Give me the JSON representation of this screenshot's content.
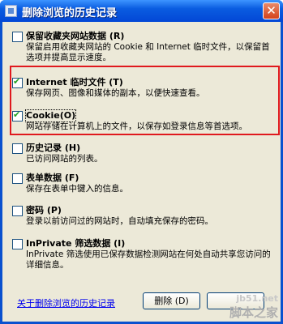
{
  "window": {
    "title": "删除浏览的历史记录",
    "close_glyph": "✕"
  },
  "options": [
    {
      "label": "保留收藏夹网站数据 (R)",
      "checked": false,
      "desc": "保留启用收藏夹网站的 Cookie 和 Internet 临时文件，以保留首选项并提高显示速度。"
    },
    {
      "label": "Internet 临时文件 (T)",
      "checked": true,
      "desc": "保存网页、图像和媒体的副本，以便快速查看。"
    },
    {
      "label": "Cookie(O)",
      "checked": true,
      "desc": "网站存储在计算机上的文件，以保存如登录信息等首选项。"
    },
    {
      "label": "历史记录 (H)",
      "checked": false,
      "desc": "已访问网站的列表。"
    },
    {
      "label": "表单数据 (F)",
      "checked": false,
      "desc": "保存在表单中键入的信息。"
    },
    {
      "label": "密码 (P)",
      "checked": false,
      "desc": "登录以前访问过的网站时，自动填充保存的密码。"
    },
    {
      "label": "InPrivate 筛选数据 (I)",
      "checked": false,
      "desc": "InPrivate 筛选使用已保存数据检测网站在何处自动共享您访问的详细信息。"
    }
  ],
  "footer": {
    "about_link": "关于删除浏览的历史记录",
    "delete_label": "删除 (D)"
  },
  "watermark": {
    "url": "jb51.net",
    "name": "脚本之家"
  }
}
